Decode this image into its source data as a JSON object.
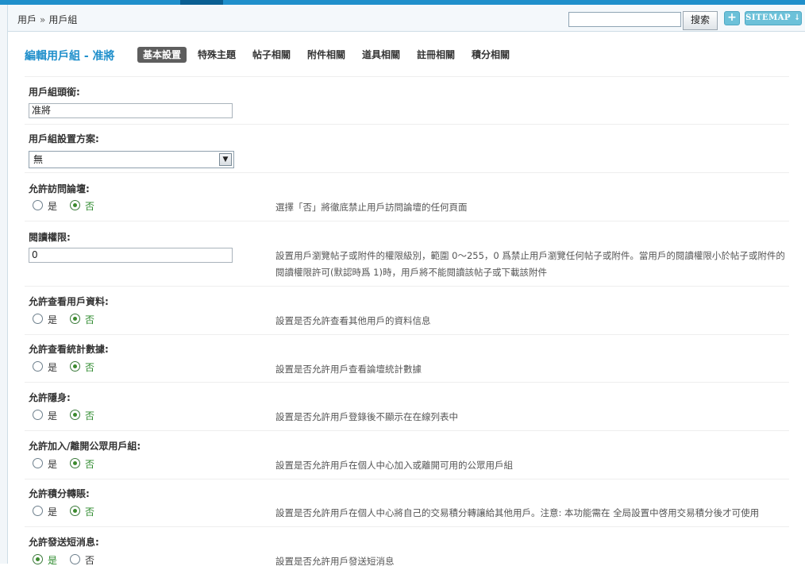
{
  "header": {
    "breadcrumb": [
      "用戶",
      "用戶組"
    ],
    "breadcrumb_sep": "»",
    "search": {
      "value": "",
      "button_label": "搜索"
    },
    "add_label": "+",
    "sitemap_label": "SITEMAP ↓"
  },
  "title": "編輯用戶組 - 准將",
  "tabs": [
    "基本設置",
    "特殊主題",
    "帖子相關",
    "附件相關",
    "道具相關",
    "註冊相關",
    "積分相關"
  ],
  "fields": {
    "group_title": {
      "label": "用戶組頭銜:",
      "value": "准將"
    },
    "scheme": {
      "label": "用戶組設置方案:",
      "value": "無"
    },
    "visit": {
      "label": "允許訪問論壇:",
      "yes": "是",
      "no": "否",
      "selected": "否",
      "desc": "選擇「否」將徹底禁止用戶訪問論壇的任何頁面"
    },
    "read_perm": {
      "label": "閱讀權限:",
      "value": "0",
      "desc": "設置用戶瀏覽帖子或附件的權限級別，範圍 0～255，0 爲禁止用戶瀏覽任何帖子或附件。當用戶的閱讀權限小於帖子或附件的閱讀權限許可(默認時爲 1)時，用戶將不能閱讀該帖子或下載該附件"
    },
    "view_profile": {
      "label": "允許查看用戶資料:",
      "yes": "是",
      "no": "否",
      "selected": "否",
      "desc": "設置是否允許查看其他用戶的資料信息"
    },
    "view_stats": {
      "label": "允許查看統計數據:",
      "yes": "是",
      "no": "否",
      "selected": "否",
      "desc": "設置是否允許用戶查看論壇統計數據"
    },
    "invisible": {
      "label": "允許隱身:",
      "yes": "是",
      "no": "否",
      "selected": "否",
      "desc": "設置是否允許用戶登錄後不顯示在在線列表中"
    },
    "join_public": {
      "label": "允許加入/離開公眾用戶組:",
      "yes": "是",
      "no": "否",
      "selected": "否",
      "desc": "設置是否允許用戶在個人中心加入或離開可用的公眾用戶組"
    },
    "transfer": {
      "label": "允許積分轉賬:",
      "yes": "是",
      "no": "否",
      "selected": "否",
      "desc": "設置是否允許用戶在個人中心將自己的交易積分轉讓給其他用戶。注意: 本功能需在 全局設置中啓用交易積分後才可使用"
    },
    "send_pm": {
      "label": "允許發送短消息:",
      "yes": "是",
      "no": "否",
      "selected": "是",
      "desc": "設置是否允許用戶發送短消息"
    }
  }
}
